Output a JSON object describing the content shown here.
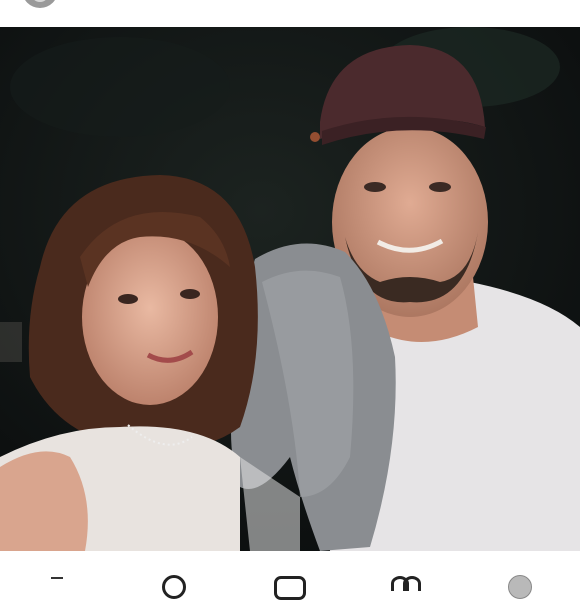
{
  "post": {
    "author_avatar_icon": "profile-avatar-icon",
    "photo_icon": "post-photo"
  },
  "navigation": {
    "items": [
      {
        "name": "home",
        "icon": "home-icon"
      },
      {
        "name": "search",
        "icon": "search-icon"
      },
      {
        "name": "new-post",
        "icon": "add-post-icon"
      },
      {
        "name": "activity",
        "icon": "heart-icon"
      },
      {
        "name": "profile",
        "icon": "profile-icon"
      }
    ]
  },
  "colors": {
    "background": "#ffffff",
    "icon": "#222222"
  }
}
